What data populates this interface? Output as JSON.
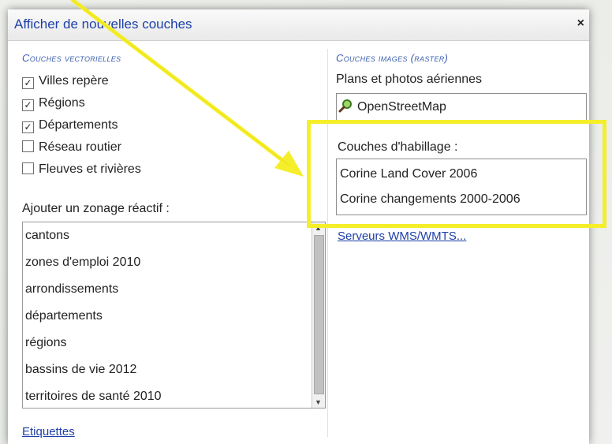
{
  "dialog": {
    "title": "Afficher de nouvelles couches",
    "close_glyph": "×"
  },
  "vector": {
    "heading": "Couches vectorielles",
    "items": [
      {
        "label": "Villes repère",
        "checked": true,
        "mark": "✓"
      },
      {
        "label": "Régions",
        "checked": true,
        "mark": "✓"
      },
      {
        "label": "Départements",
        "checked": true,
        "mark": "✓"
      },
      {
        "label": "Réseau routier",
        "checked": false,
        "mark": ""
      },
      {
        "label": "Fleuves et rivières",
        "checked": false,
        "mark": ""
      }
    ]
  },
  "zonage": {
    "label": "Ajouter un zonage réactif :",
    "items": [
      "cantons",
      "zones d'emploi 2010",
      "arrondissements",
      "départements",
      "régions",
      "bassins de vie 2012",
      "territoires de santé 2010"
    ]
  },
  "raster": {
    "heading": "Couches images (raster)",
    "plans_label": "Plans et photos aériennes",
    "plans_items": [
      "OpenStreetMap"
    ],
    "habillage_label": "Couches d'habillage :",
    "habillage_items": [
      "Corine Land Cover 2006",
      "Corine changements 2000-2006"
    ],
    "servers_link": "Serveurs WMS/WMTS..."
  },
  "footer": {
    "labels_link": "Etiquettes"
  },
  "colors": {
    "highlight": "#f5ee2a",
    "link": "#1c3fa8",
    "section_heading": "#3c5fb0"
  }
}
